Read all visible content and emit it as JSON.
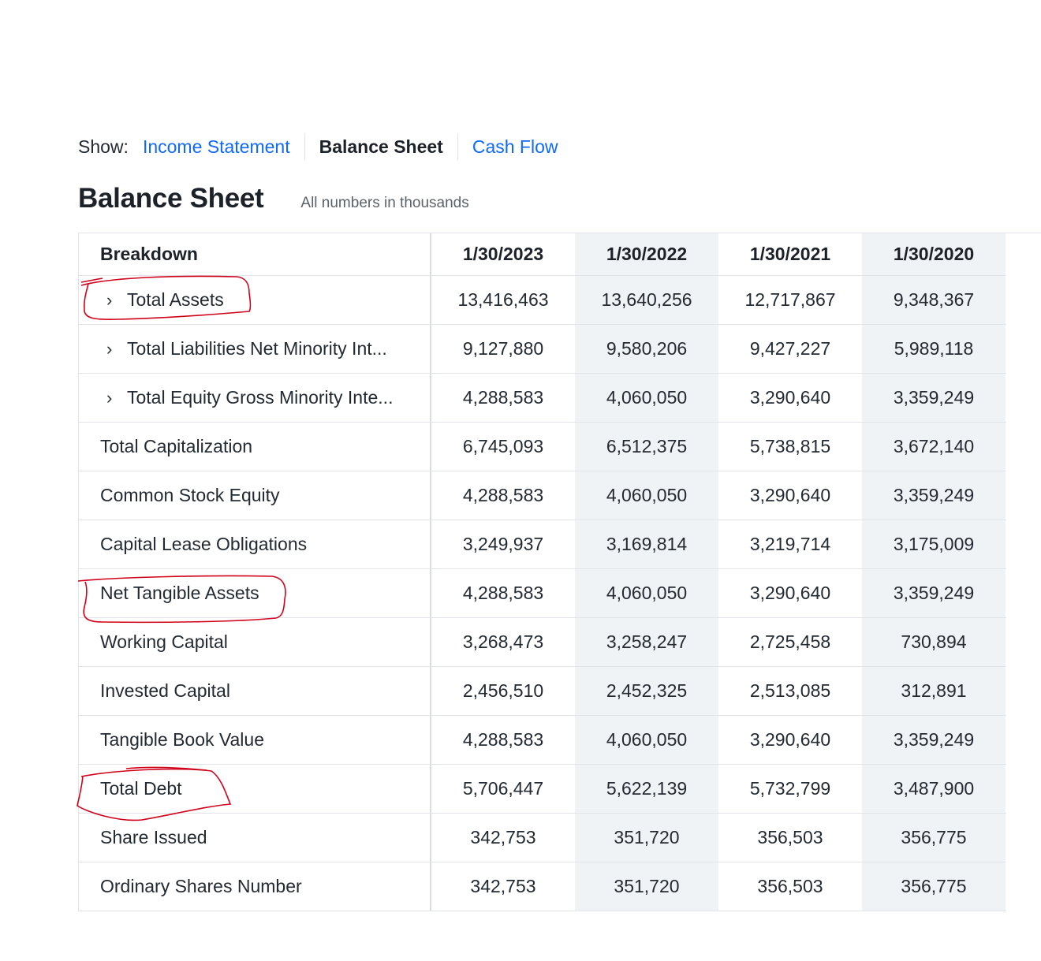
{
  "nav": {
    "show_label": "Show:",
    "tabs": [
      {
        "label": "Income Statement",
        "active": false
      },
      {
        "label": "Balance Sheet",
        "active": true
      },
      {
        "label": "Cash Flow",
        "active": false
      }
    ]
  },
  "section": {
    "title": "Balance Sheet",
    "note": "All numbers in thousands"
  },
  "table": {
    "columns": [
      "Breakdown",
      "1/30/2023",
      "1/30/2022",
      "1/30/2021",
      "1/30/2020"
    ],
    "rows": [
      {
        "label": "Total Assets",
        "expandable": true,
        "values": [
          "13,416,463",
          "13,640,256",
          "12,717,867",
          "9,348,367"
        ]
      },
      {
        "label": "Total Liabilities Net Minority Int...",
        "expandable": true,
        "values": [
          "9,127,880",
          "9,580,206",
          "9,427,227",
          "5,989,118"
        ]
      },
      {
        "label": "Total Equity Gross Minority Inte...",
        "expandable": true,
        "values": [
          "4,288,583",
          "4,060,050",
          "3,290,640",
          "3,359,249"
        ]
      },
      {
        "label": "Total Capitalization",
        "expandable": false,
        "values": [
          "6,745,093",
          "6,512,375",
          "5,738,815",
          "3,672,140"
        ]
      },
      {
        "label": "Common Stock Equity",
        "expandable": false,
        "values": [
          "4,288,583",
          "4,060,050",
          "3,290,640",
          "3,359,249"
        ]
      },
      {
        "label": "Capital Lease Obligations",
        "expandable": false,
        "values": [
          "3,249,937",
          "3,169,814",
          "3,219,714",
          "3,175,009"
        ]
      },
      {
        "label": "Net Tangible Assets",
        "expandable": false,
        "values": [
          "4,288,583",
          "4,060,050",
          "3,290,640",
          "3,359,249"
        ]
      },
      {
        "label": "Working Capital",
        "expandable": false,
        "values": [
          "3,268,473",
          "3,258,247",
          "2,725,458",
          "730,894"
        ]
      },
      {
        "label": "Invested Capital",
        "expandable": false,
        "values": [
          "2,456,510",
          "2,452,325",
          "2,513,085",
          "312,891"
        ]
      },
      {
        "label": "Tangible Book Value",
        "expandable": false,
        "values": [
          "4,288,583",
          "4,060,050",
          "3,290,640",
          "3,359,249"
        ]
      },
      {
        "label": "Total Debt",
        "expandable": false,
        "values": [
          "5,706,447",
          "5,622,139",
          "5,732,799",
          "3,487,900"
        ]
      },
      {
        "label": "Share Issued",
        "expandable": false,
        "values": [
          "342,753",
          "351,720",
          "356,503",
          "356,775"
        ]
      },
      {
        "label": "Ordinary Shares Number",
        "expandable": false,
        "values": [
          "342,753",
          "351,720",
          "356,503",
          "356,775"
        ]
      }
    ]
  },
  "colors": {
    "link": "#0f69ff",
    "shaded_column": "#f0f3f5",
    "annotation": "#d0021b"
  },
  "annotations": {
    "circled_rows": [
      "Total Assets",
      "Net Tangible Assets",
      "Total Debt"
    ]
  }
}
